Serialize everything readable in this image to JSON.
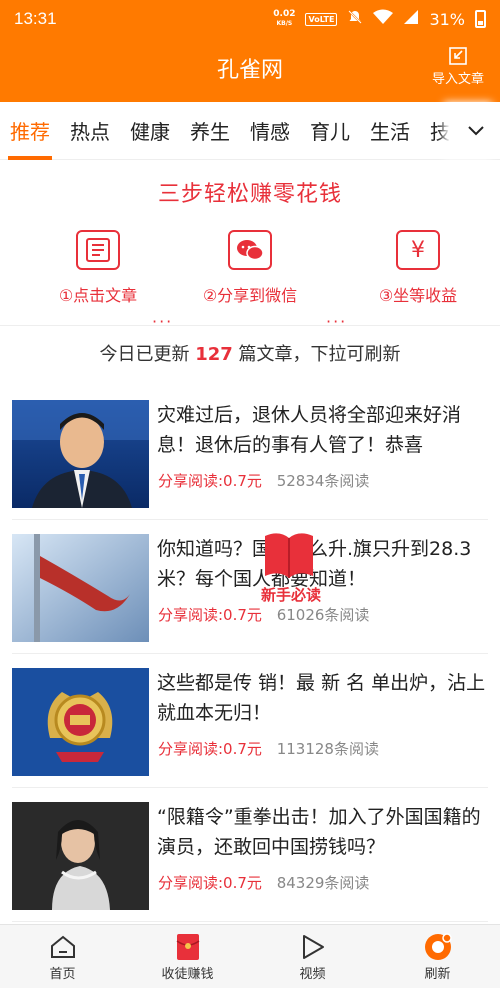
{
  "status_bar": {
    "time": "13:31",
    "net_speed_value": "0.02",
    "net_speed_unit": "KB/S",
    "volte": "VoLTE",
    "battery": "31%"
  },
  "header": {
    "title": "孔雀网",
    "import_label": "导入文章"
  },
  "tabs": [
    "推荐",
    "热点",
    "健康",
    "养生",
    "情感",
    "育儿",
    "生活",
    "技"
  ],
  "active_tab": "推荐",
  "banner": {
    "title": "三步轻松赚零花钱",
    "steps": [
      "①点击文章",
      "②分享到微信",
      "③坐等收益"
    ],
    "separator": "···"
  },
  "update_notice": {
    "prefix": "今日已更新",
    "count": "127",
    "suffix": "篇文章，下拉可刷新"
  },
  "articles": [
    {
      "title": "灾难过后，退休人员将全部迎来好消息！退休后的事有人管了！恭喜",
      "reward": "分享阅读:0.7元",
      "reads": "52834条阅读"
    },
    {
      "title": "你知道吗？国旗怎么升.旗只升到28.3米？每个国人都要知道！",
      "reward": "分享阅读:0.7元",
      "reads": "61026条阅读"
    },
    {
      "title": "这些都是传 销！最 新 名 单出炉，沾上就血本无归！",
      "reward": "分享阅读:0.7元",
      "reads": "113128条阅读"
    },
    {
      "title": "“限籍令”重拳出击！加入了外国国籍的演员，还敢回中国捞钱吗？",
      "reward": "分享阅读:0.7元",
      "reads": "84329条阅读"
    }
  ],
  "badge": {
    "label": "新手必读"
  },
  "bottom_nav": [
    "首页",
    "收徒赚钱",
    "视频",
    "刷新"
  ],
  "colors": {
    "brand": "#ff7a00",
    "accent_red": "#e8303a",
    "tab_active": "#ff6a00"
  }
}
